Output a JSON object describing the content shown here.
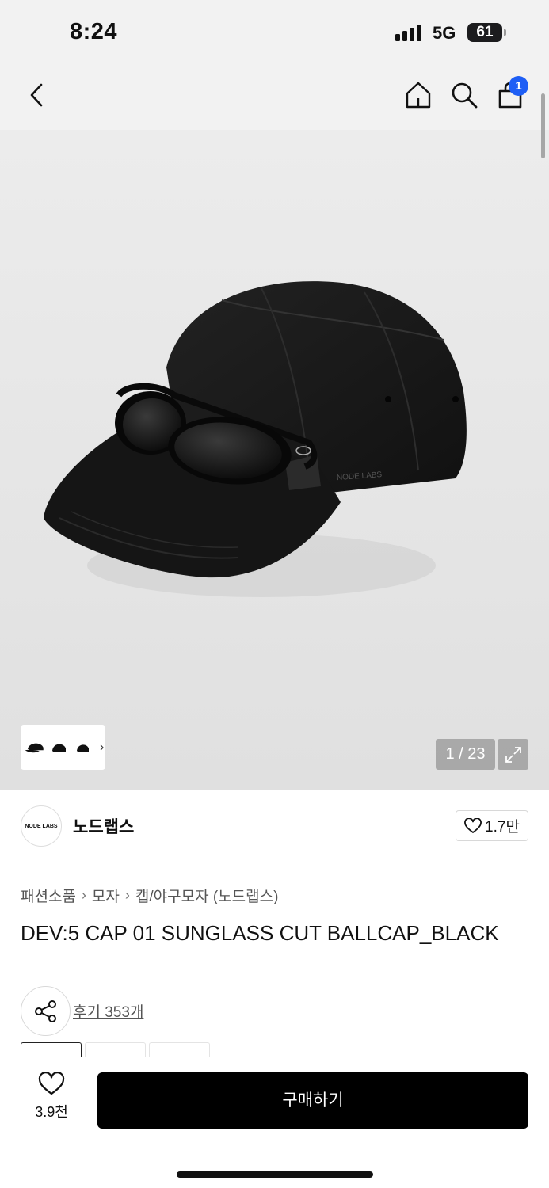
{
  "status_bar": {
    "time": "8:24",
    "network": "5G",
    "battery": "61"
  },
  "nav": {
    "icons": [
      "back-chevron-icon",
      "home-icon",
      "search-icon",
      "shopping-bag-icon"
    ],
    "cart_badge": "1"
  },
  "gallery": {
    "counter": "1 / 23",
    "thumbnail_count": 3,
    "logo_print": "NODE LABS"
  },
  "brand": {
    "logo_text": "NODE LABS",
    "name": "노드랩스",
    "likes": "1.7만"
  },
  "breadcrumb": [
    "패션소품",
    "모자",
    "캡/야구모자 (노드랩스)"
  ],
  "product": {
    "title": "DEV:5 CAP 01 SUNGLASS CUT BALLCAP_BLACK",
    "reviews": "후기 353개"
  },
  "bottom_bar": {
    "wish_count": "3.9천",
    "buy_label": "구매하기"
  },
  "colors": {
    "accent_badge": "#1e5ef5",
    "buy_button": "#000000",
    "header_bg": "#f2f2f2"
  }
}
